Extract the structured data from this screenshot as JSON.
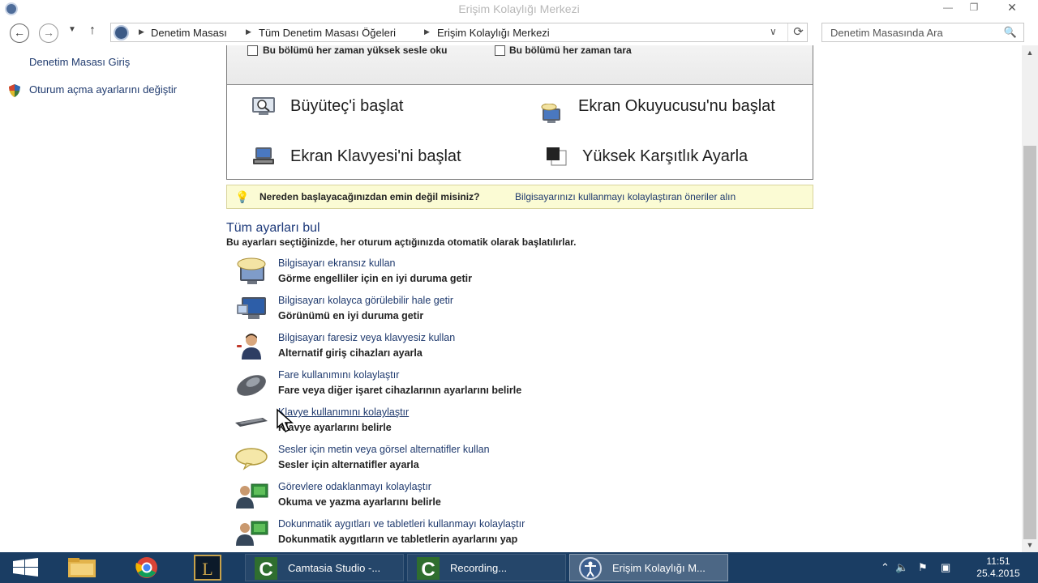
{
  "window": {
    "title": "Erişim Kolaylığı Merkezi",
    "controls": {
      "minimize": "—",
      "maximize": "❐",
      "close": "✕"
    }
  },
  "nav": {
    "back": "←",
    "forward": "→",
    "recent": "▼",
    "up": "↑",
    "breadcrumbs": [
      "Denetim Masası",
      "Tüm Denetim Masası Öğeleri",
      "Erişim Kolaylığı Merkezi"
    ],
    "separator": "▶",
    "dropdown": "∨",
    "refresh": "⟳",
    "search_placeholder": "Denetim Masasında Ara",
    "search_icon": "🔍"
  },
  "sidebar": {
    "home": "Denetim Masası Giriş",
    "logon_settings": "Oturum açma ayarlarını değiştir"
  },
  "quick_access": {
    "checkbox_always_read": "Bu bölümü her zaman yüksek sesle oku",
    "checkbox_always_scan": "Bu bölümü her zaman tara",
    "items": [
      {
        "label": "Büyüteç'i başlat",
        "icon": "magnifier-icon"
      },
      {
        "label": "Ekran Okuyucusu'nu başlat",
        "icon": "narrator-icon"
      },
      {
        "label": "Ekran Klavyesi'ni başlat",
        "icon": "on-screen-keyboard-icon"
      },
      {
        "label": "Yüksek Karşıtlık Ayarla",
        "icon": "high-contrast-icon"
      }
    ]
  },
  "tip": {
    "icon": "💡",
    "question": "Nereden başlayacağınızdan emin değil misiniz?",
    "link": "Bilgisayarınızı kullanmayı kolaylaştıran öneriler alın"
  },
  "all_settings": {
    "heading": "Tüm ayarları bul",
    "subheading": "Bu ayarları seçtiğinizde, her oturum açtığınızda otomatik olarak başlatılırlar.",
    "items": [
      {
        "link": "Bilgisayarı ekransız kullan",
        "desc": "Görme engelliler için en iyi duruma getir",
        "icon": "monitor-sound-icon"
      },
      {
        "link": "Bilgisayarı kolayca görülebilir hale getir",
        "desc": "Görünümü en iyi duruma getir",
        "icon": "monitor-visual-icon"
      },
      {
        "link": "Bilgisayarı faresiz veya klavyesiz kullan",
        "desc": "Alternatif giriş cihazları ayarla",
        "icon": "person-speech-icon"
      },
      {
        "link": "Fare kullanımını kolaylaştır",
        "desc": "Fare veya diğer işaret cihazlarının ayarlarını belirle",
        "icon": "mouse-icon"
      },
      {
        "link": "Klavye kullanımını kolaylaştır",
        "desc": "Klavye ayarlarını belirle",
        "icon": "keyboard-icon"
      },
      {
        "link": "Sesler için metin veya görsel alternatifler kullan",
        "desc": "Sesler için alternatifler ayarla",
        "icon": "speech-bubble-icon"
      },
      {
        "link": "Görevlere odaklanmayı kolaylaştır",
        "desc": "Okuma ve yazma ayarlarını belirle",
        "icon": "person-screen-icon"
      },
      {
        "link": "Dokunmatik aygıtları ve tabletleri kullanmayı kolaylaştır",
        "desc": "Dokunmatik aygıtların ve tabletlerin ayarlarını yap",
        "icon": "person-tablet-icon"
      }
    ]
  },
  "taskbar": {
    "tasks": [
      {
        "label": "Camtasia Studio -...",
        "icon": "camtasia-icon"
      },
      {
        "label": "Recording...",
        "icon": "camtasia-recorder-icon"
      },
      {
        "label": "Erişim Kolaylığı M...",
        "icon": "ease-of-access-icon"
      }
    ],
    "clock_time": "11:51",
    "clock_date": "25.4.2015"
  },
  "colors": {
    "link": "#1f3a6e",
    "taskbar": "#1a3d63",
    "tip_bg": "#fbfbd4"
  }
}
